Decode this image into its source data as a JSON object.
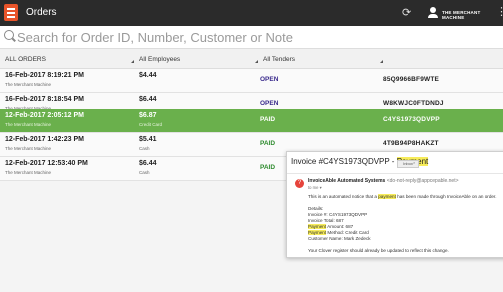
{
  "app": {
    "title": "Orders",
    "merchant_name": "THE MERCHANT MACHINE"
  },
  "search": {
    "placeholder": "Search for Order ID, Number, Customer or Note"
  },
  "filters": {
    "orders": "ALL ORDERS",
    "employees": "All Employees",
    "tenders": "All Tenders"
  },
  "rows": [
    {
      "date": "16-Feb-2017 8:19:21 PM",
      "merchant": "The Merchant Machine",
      "amount": "$4.44",
      "tender": "",
      "status": "OPEN",
      "order_id": "85Q9966BF9WTE"
    },
    {
      "date": "16-Feb-2017 8:18:54 PM",
      "merchant": "The Merchant Machine",
      "amount": "$6.44",
      "tender": "",
      "status": "OPEN",
      "order_id": "W8KWJC0FTDNDJ"
    },
    {
      "date": "12-Feb-2017 2:05:12 PM",
      "merchant": "The Merchant Machine",
      "amount": "$6.87",
      "tender": "Credit Card",
      "status": "PAID",
      "order_id": "C4YS1973QDVPP"
    },
    {
      "date": "12-Feb-2017 1:42:23 PM",
      "merchant": "The Merchant Machine",
      "amount": "$5.41",
      "tender": "Cash",
      "status": "PAID",
      "order_id": "4T9B94P8HAKZT"
    },
    {
      "date": "12-Feb-2017 12:53:40 PM",
      "merchant": "The Merchant Machine",
      "amount": "$6.44",
      "tender": "Cash",
      "status": "PAID",
      "order_id": ""
    }
  ],
  "email": {
    "subject_prefix": "Invoice #C4YS1973QDVPP - ",
    "subject_highlight": "Payment",
    "inbox_label": "Inbox",
    "sender_name": "InvoiceAble Automated Systems",
    "sender_addr": "<do-not-reply@appcepable.net>",
    "to_me": "to me",
    "line1_a": "This is an automated notice that a ",
    "line1_hl": "payment",
    "line1_b": " has been made through InvoiceAble on an order.",
    "details_label": "Details:",
    "invoice_line": "Invoice #: C4YS1973QDVPP",
    "total_line": "Invoice Total: 687",
    "amount_label": "Payment",
    "amount_value": " Amount: 687",
    "method_label": "Payment",
    "method_value": " Method: Credit Card",
    "customer_line": "Customer Name: Mark Zedeck",
    "footer": "Your Clover register should already be updated to reflect this change."
  },
  "colors": {
    "topbar": "#2b2b2b",
    "app_icon": "#e8542a",
    "selected_row": "#6ab04c",
    "open_status": "#3a2a8c",
    "paid_status": "#2e8b2e",
    "highlight": "#f7ec5a"
  },
  "icons": [
    "orders-app-icon",
    "refresh-icon",
    "user-icon",
    "more-icon",
    "search-icon",
    "sender-avatar-icon"
  ]
}
